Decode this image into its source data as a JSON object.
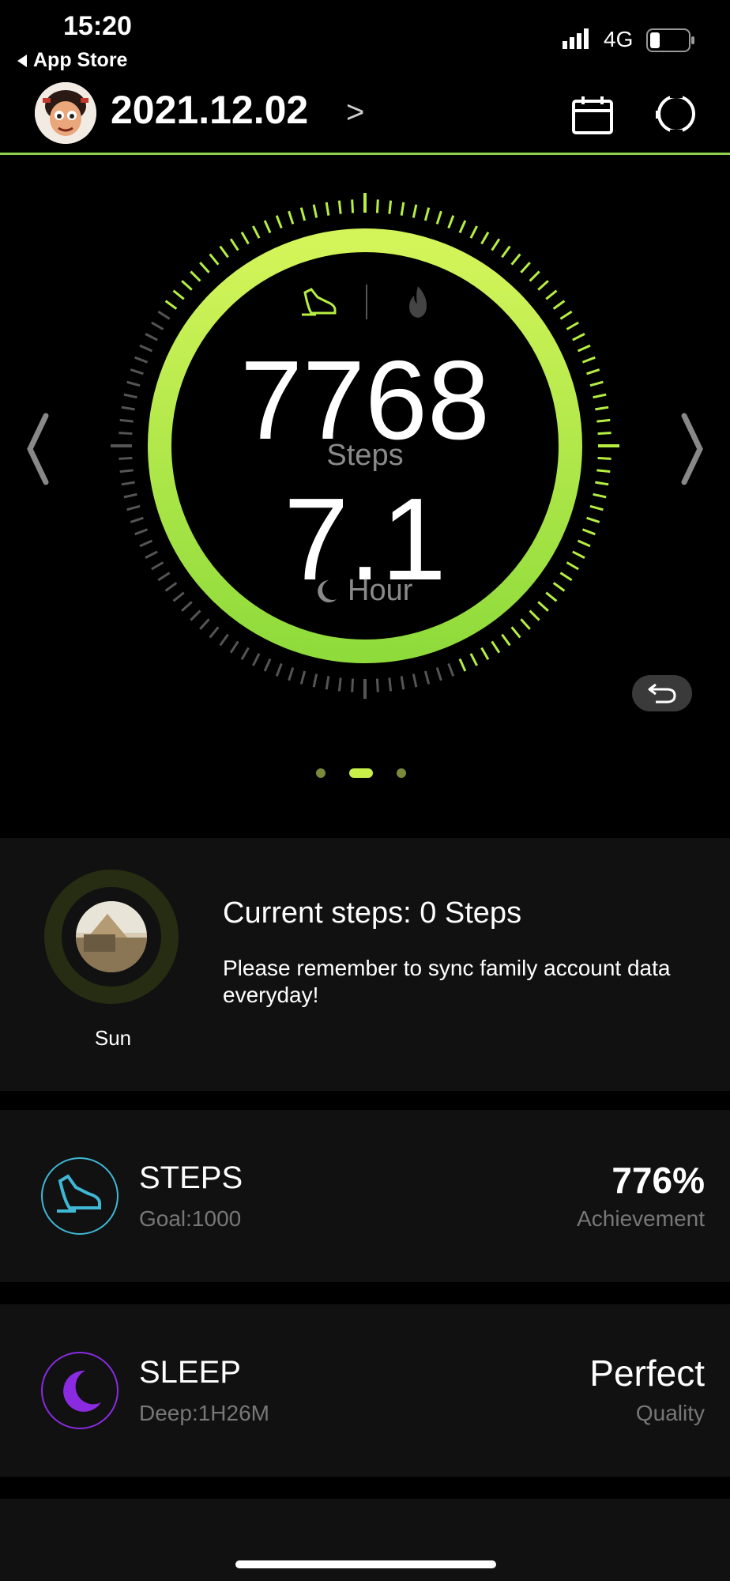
{
  "status_bar": {
    "time": "15:20",
    "back_app": "App Store",
    "network": "4G"
  },
  "header": {
    "date": "2021.12.02",
    "date_arrow": ">"
  },
  "activity": {
    "steps_value": "7768",
    "steps_label": "Steps",
    "sleep_value": "7.1",
    "sleep_label": "Hour",
    "page_count": 3,
    "active_page": 2,
    "accent_color": "#b6ef42"
  },
  "family": {
    "member_name": "Sun",
    "current_steps": "Current steps: 0 Steps",
    "sync_message": "Please remember to sync family account data everyday!"
  },
  "steps_card": {
    "title": "STEPS",
    "goal": "Goal:1000",
    "value": "776%",
    "value_label": "Achievement",
    "icon_color": "#3fb8d6"
  },
  "sleep_card": {
    "title": "SLEEP",
    "deep": "Deep:1H26M",
    "value": "Perfect",
    "value_label": "Quality",
    "icon_color": "#8a2be2"
  }
}
